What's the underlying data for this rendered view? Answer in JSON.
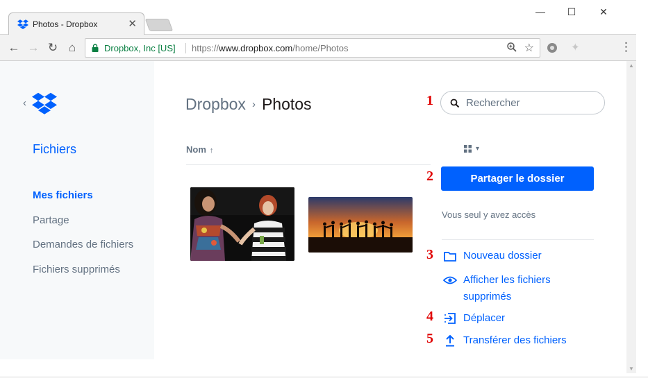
{
  "browser": {
    "tab_title": "Photos - Dropbox",
    "tab_close": "✕",
    "window_min": "—",
    "window_max": "☐",
    "window_close": "✕",
    "back": "←",
    "forward": "→",
    "reload": "↻",
    "home": "⌂",
    "secure_label": "Dropbox, Inc [US]",
    "url_scheme": "https://",
    "url_host": "www.dropbox.com",
    "url_path": "/home/Photos",
    "menu": "⋮"
  },
  "sidebar": {
    "collapse": "‹",
    "section_title": "Fichiers",
    "items": [
      {
        "label": "Mes fichiers"
      },
      {
        "label": "Partage"
      },
      {
        "label": "Demandes de fichiers"
      },
      {
        "label": "Fichiers supprimés"
      }
    ]
  },
  "breadcrumb": {
    "root": "Dropbox",
    "separator": "›",
    "current": "Photos"
  },
  "file_list": {
    "sort_column": "Nom",
    "sort_arrow": "↑",
    "view_caret": "▾"
  },
  "search": {
    "placeholder": "Rechercher"
  },
  "share": {
    "button_label": "Partager le dossier",
    "access_text": "Vous seul y avez accès"
  },
  "actions": [
    {
      "label": "Nouveau dossier"
    },
    {
      "label": "Afficher les fichiers supprimés"
    },
    {
      "label": "Déplacer"
    },
    {
      "label": "Transférer des fichiers"
    }
  ],
  "annotations": [
    "1",
    "2",
    "3",
    "4",
    "5"
  ],
  "colors": {
    "accent": "#0061fe",
    "annotation": "#e00000",
    "muted_text": "#637282",
    "sidebar_bg": "#f7f9fa"
  }
}
